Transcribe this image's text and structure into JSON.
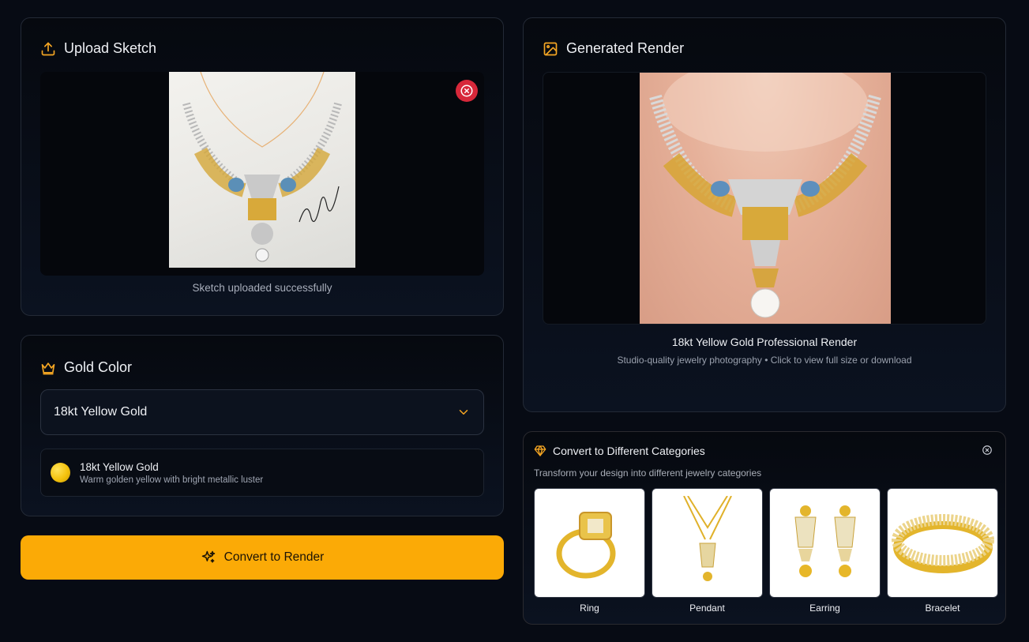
{
  "upload": {
    "title": "Upload Sketch",
    "status": "Sketch uploaded successfully",
    "icon": "upload-icon"
  },
  "gold": {
    "title": "Gold Color",
    "selected": "18kt Yellow Gold",
    "info_name": "18kt Yellow Gold",
    "info_desc": "Warm golden yellow with bright metallic luster",
    "swatch_color": "#f4c20d"
  },
  "convert": {
    "label": "Convert to Render",
    "color": "#fbaa06"
  },
  "render": {
    "title": "Generated Render",
    "caption": "18kt Yellow Gold Professional Render",
    "subcaption": "Studio-quality jewelry photography • Click to view full size or download"
  },
  "categories": {
    "title": "Convert to Different Categories",
    "subtitle": "Transform your design into different jewelry categories",
    "items": [
      {
        "label": "Ring"
      },
      {
        "label": "Pendant"
      },
      {
        "label": "Earring"
      },
      {
        "label": "Bracelet"
      }
    ]
  },
  "colors": {
    "accent": "#f5a623",
    "danger": "#d7283a",
    "background": "#070b14"
  }
}
